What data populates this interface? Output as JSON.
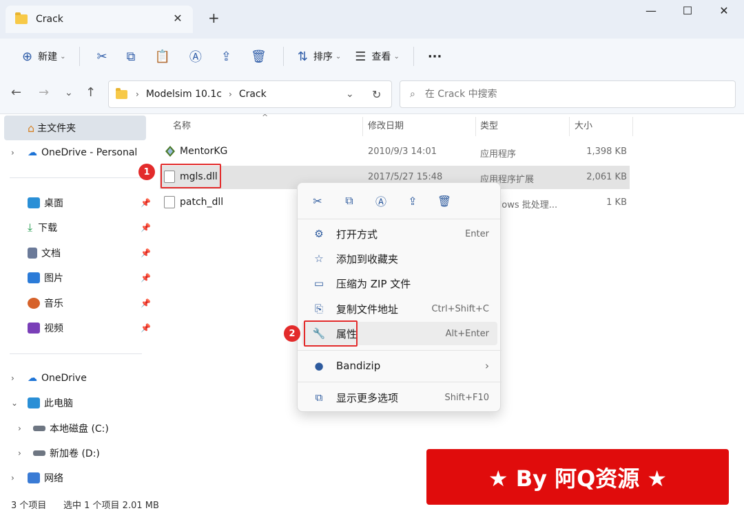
{
  "tab": {
    "title": "Crack",
    "close": "✕",
    "new": "+"
  },
  "window": {
    "minimize": "—",
    "maximize": "☐",
    "close": "✕"
  },
  "toolbar": {
    "new_label": "新建",
    "sort_label": "排序",
    "view_label": "查看",
    "more": "···"
  },
  "address": {
    "crumbs": [
      "Modelsim 10.1c",
      "Crack"
    ],
    "search_placeholder": "在 Crack 中搜索"
  },
  "sidebar": {
    "home": "主文件夹",
    "onedrive_personal": "OneDrive - Personal",
    "quick": [
      {
        "label": "桌面",
        "color": "#2a8fd6"
      },
      {
        "label": "下载",
        "color": "#1f9a4b"
      },
      {
        "label": "文档",
        "color": "#6b7a99"
      },
      {
        "label": "图片",
        "color": "#2b7bd8"
      },
      {
        "label": "音乐",
        "color": "#d6622a"
      },
      {
        "label": "视频",
        "color": "#7a3fb8"
      }
    ],
    "onedrive": "OneDrive",
    "this_pc": "此电脑",
    "drive_c": "本地磁盘 (C:)",
    "drive_d": "新加卷 (D:)",
    "network": "网络"
  },
  "columns": {
    "name": "名称",
    "modified": "修改日期",
    "type": "类型",
    "size": "大小"
  },
  "files": [
    {
      "name": "MentorKG",
      "modified": "2010/9/3 14:01",
      "type": "应用程序",
      "size": "1,398 KB"
    },
    {
      "name": "mgls.dll",
      "modified": "2017/5/27 15:48",
      "type": "应用程序扩展",
      "size": "2,061 KB"
    },
    {
      "name": "patch_dll",
      "modified": "",
      "type": "dows 批处理...",
      "size": "1 KB"
    }
  ],
  "context_menu": {
    "items": [
      {
        "label": "打开方式",
        "shortcut": "Enter"
      },
      {
        "label": "添加到收藏夹",
        "shortcut": ""
      },
      {
        "label": "压缩为 ZIP 文件",
        "shortcut": ""
      },
      {
        "label": "复制文件地址",
        "shortcut": "Ctrl+Shift+C"
      },
      {
        "label": "属性",
        "shortcut": "Alt+Enter"
      },
      {
        "label": "Bandizip",
        "shortcut": ""
      },
      {
        "label": "显示更多选项",
        "shortcut": "Shift+F10"
      }
    ]
  },
  "annotations": {
    "badge1": "1",
    "badge2": "2"
  },
  "status": {
    "count": "3 个项目",
    "selection": "选中 1 个项目  2.01 MB"
  },
  "banner": "★ By 阿Q资源 ★"
}
